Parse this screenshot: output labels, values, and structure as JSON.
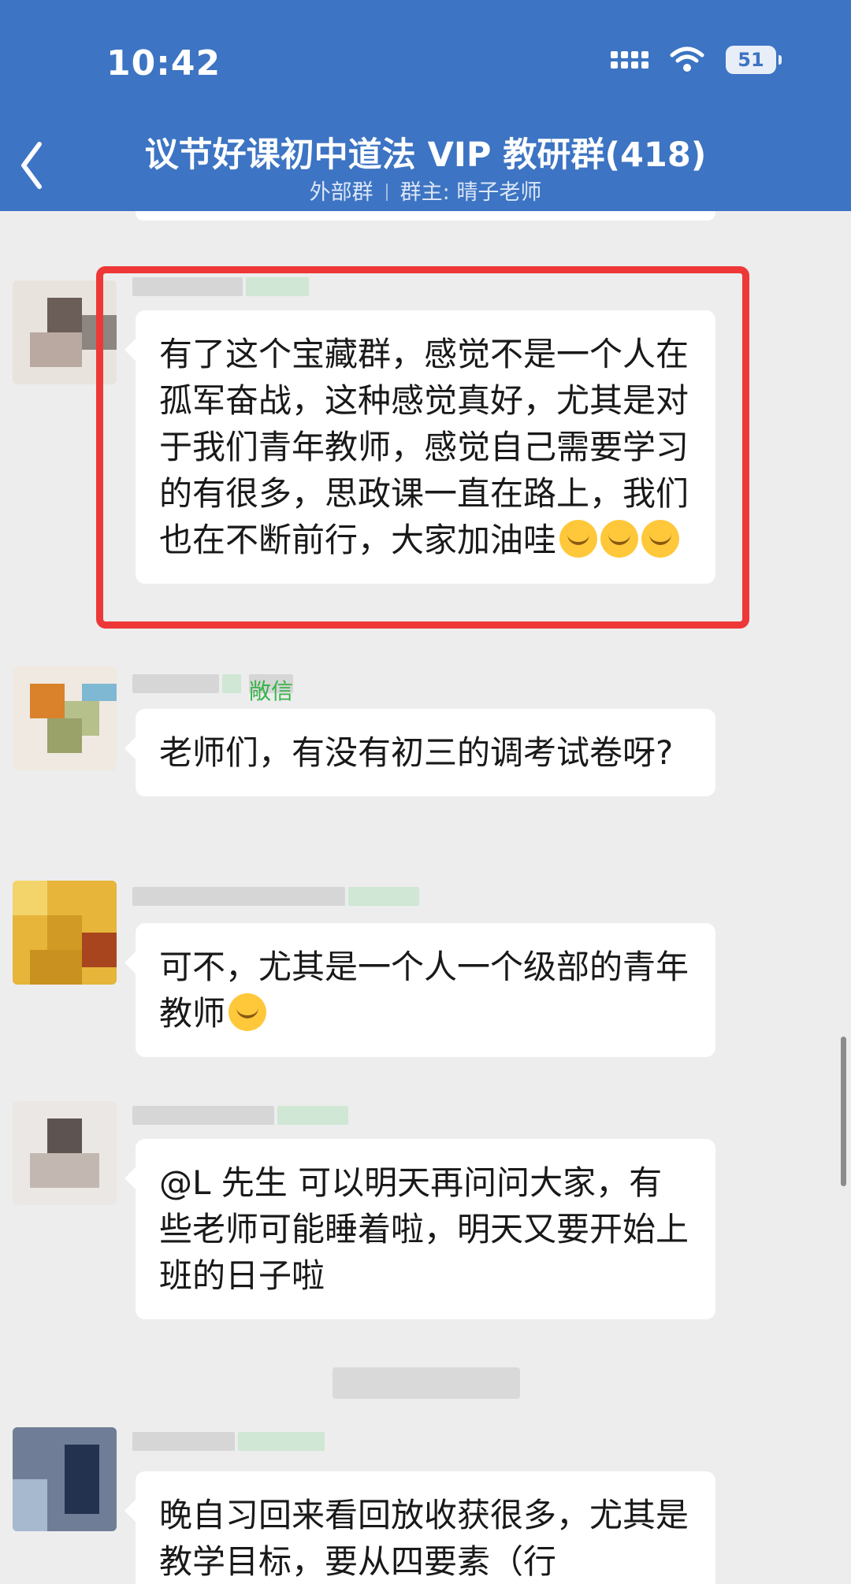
{
  "status_bar": {
    "time": "10:42",
    "battery": "51"
  },
  "header": {
    "title": "议节好课初中道法 VIP 教研群(418)",
    "subtitle_left": "外部群",
    "subtitle_right": "群主: 晴子老师"
  },
  "messages": [
    {
      "text": "有了这个宝藏群，感觉不是一个人在孤军奋战，这种感觉真好，尤其是对于我们青年教师，感觉自己需要学习的有很多，思政课一直在路上，我们也在不断前行，大家加油哇"
    },
    {
      "tag": "敞信",
      "text": "老师们，有没有初三的调考试卷呀?"
    },
    {
      "text": "可不，尤其是一个人一个级部的青年教师"
    },
    {
      "text": "@L 先生 可以明天再问问大家，有些老师可能睡着啦，明天又要开始上班的日子啦"
    },
    {
      "text": "晚自习回来看回放收获很多，尤其是教学目标，要从四要素（行"
    }
  ],
  "colors": {
    "header": "#3d74c3",
    "highlight": "#ee3838",
    "tag": "#38b44a"
  }
}
